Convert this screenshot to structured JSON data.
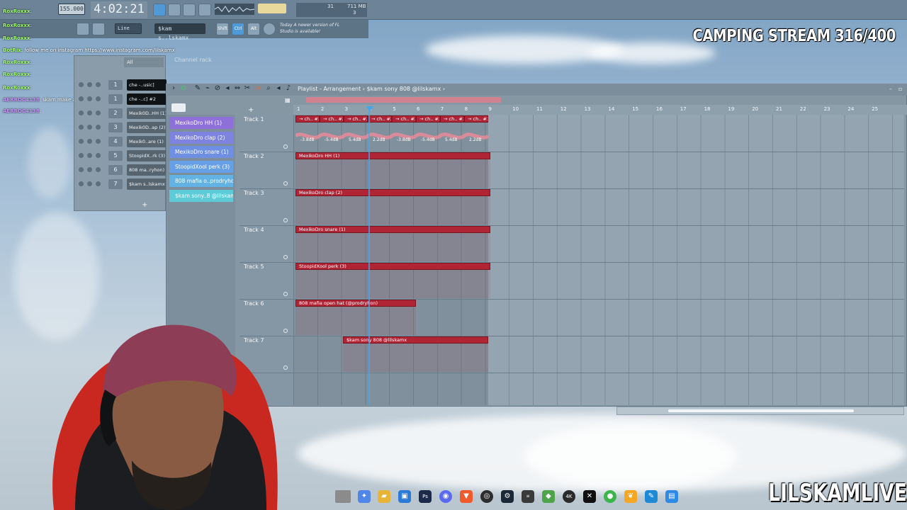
{
  "overlay": {
    "stream_title": "CAMPING STREAM 316/400",
    "brand": "LILSKAMLIVE"
  },
  "toolbar": {
    "tempo": "155.000",
    "time": "4:02:21",
    "cpu_value": "31",
    "memory": "711 MB",
    "voices": "3",
    "snap_mode": "Line",
    "active_pattern": "$kam s..lskamx",
    "btn_shift": "Shift",
    "btn_ctrl": "Ctrl",
    "btn_alt": "Alt",
    "news": "Today  A newer version of FL Studio is available!"
  },
  "chat": [
    {
      "user": "RoxRoxxx",
      "text": ":"
    },
    {
      "user": "RoxRoxxx",
      "text": ":"
    },
    {
      "user": "RoxRoxxx",
      "text": ":"
    },
    {
      "user": "BotRix",
      "text": ": follow me on instagram https://www.instagram.com/lilskamx"
    },
    {
      "user": "RoxRoxxx",
      "text": ":"
    },
    {
      "user": "RoxRoxxx",
      "text": ":"
    },
    {
      "user": "RoxRoxxx",
      "text": ":"
    },
    {
      "user": "AERROC4138",
      "text": ": skam make a diva beat"
    },
    {
      "user": "AERROC4138",
      "text": ":"
    }
  ],
  "channel_rack": {
    "title": "Channel rack",
    "filter": "All",
    "channels": [
      {
        "num": "1",
        "name": "che -..usic]",
        "dark": true
      },
      {
        "num": "1",
        "name": "che -..c] #2",
        "dark": true
      },
      {
        "num": "2",
        "name": "Mexik0D..HH (1)",
        "dark": false
      },
      {
        "num": "3",
        "name": "Mexik0D..ap (2)",
        "dark": false
      },
      {
        "num": "4",
        "name": "Mexik0..are (1)",
        "dark": false
      },
      {
        "num": "5",
        "name": "StoopidX..rk (3)",
        "dark": false
      },
      {
        "num": "6",
        "name": "808 ma..ryhon)",
        "dark": false
      },
      {
        "num": "7",
        "name": "$kam s..lskamx",
        "dark": false
      }
    ]
  },
  "playlist": {
    "title": "Playlist - Arrangement › $kam sony 808 @lilskamx ›",
    "ruler": [
      "1",
      "2",
      "3",
      "4",
      "5",
      "6",
      "7",
      "8",
      "9",
      "10",
      "11",
      "12",
      "13",
      "14",
      "15",
      "16",
      "17",
      "18",
      "19",
      "20",
      "21",
      "22",
      "23",
      "24",
      "25"
    ],
    "patterns": [
      {
        "label": "MexikoDro HH (1)",
        "color": "#8f6fd8"
      },
      {
        "label": "MexikoDro clap (2)",
        "color": "#7d83df"
      },
      {
        "label": "MexikoDro snare (1)",
        "color": "#6f8fe3"
      },
      {
        "label": "StoopidXool perk (3)",
        "color": "#66a0e6"
      },
      {
        "label": "808 mafia o..prodryhon)",
        "color": "#62b3e4"
      },
      {
        "label": "$kam sony..8 @lilskamx",
        "color": "#5ecbd9"
      }
    ],
    "tracks": [
      "Track 1",
      "Track 2",
      "Track 3",
      "Track 4",
      "Track 5",
      "Track 6",
      "Track 7"
    ],
    "automation_clip_label": "→ ch.. #2",
    "db_labels": [
      "-3.8dB",
      "-5.4dB",
      "5.4dB",
      "2.2dB",
      "-3.8dB",
      "-5.4dB",
      "5.4dB",
      "2.2dB"
    ],
    "clips": [
      {
        "label": "MexikoDro HH (1)"
      },
      {
        "label": "MexikoDro clap (2)"
      },
      {
        "label": "MexikoDro snare (1)"
      },
      {
        "label": "StoopidXool perk (3)"
      },
      {
        "label": "808 mafia open hat (@prodryhon)"
      },
      {
        "label": "$kam sony 808 @lilskamx"
      }
    ]
  }
}
